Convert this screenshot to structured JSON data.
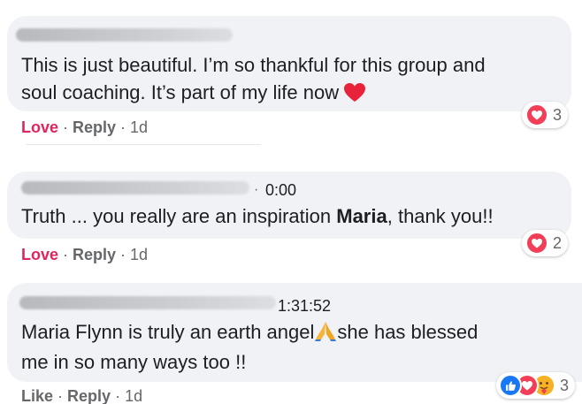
{
  "comments": [
    {
      "author_redacted": true,
      "time": "",
      "line1": "This is just beautiful. I’m so thankful for this group and",
      "line2": "soul coaching. It’s part of my life now",
      "actions": {
        "primary": "Love",
        "reply": "Reply",
        "age": "1d"
      },
      "reactions": {
        "types": [
          "heart-icon"
        ],
        "count": "3"
      }
    },
    {
      "author_redacted": true,
      "time": "0:00",
      "line1_pre": "Truth ... you really are an inspiration ",
      "line1_bold": "Maria",
      "line1_post": ", thank you!!",
      "actions": {
        "primary": "Love",
        "reply": "Reply",
        "age": "1d"
      },
      "reactions": {
        "types": [
          "heart-icon"
        ],
        "count": "2"
      }
    },
    {
      "author_redacted": true,
      "time": "1:31:52",
      "line1_pre": "Maria Flynn is truly an earth angel",
      "line1_post": "she has blessed",
      "line2": "me in so many ways too !!",
      "actions": {
        "primary": "Like",
        "reply": "Reply",
        "age": "1d"
      },
      "reactions": {
        "types": [
          "thumbs-up-icon",
          "heart-icon",
          "care-face-icon"
        ],
        "count": "3"
      }
    }
  ],
  "separator": "·",
  "colors": {
    "bubble": "#f0f2f5",
    "love": "#e0245e",
    "like_blue": "#1877f2",
    "heart_red": "#f33e58",
    "care_yellow": "#f7b125",
    "meta_gray": "#65676b"
  }
}
